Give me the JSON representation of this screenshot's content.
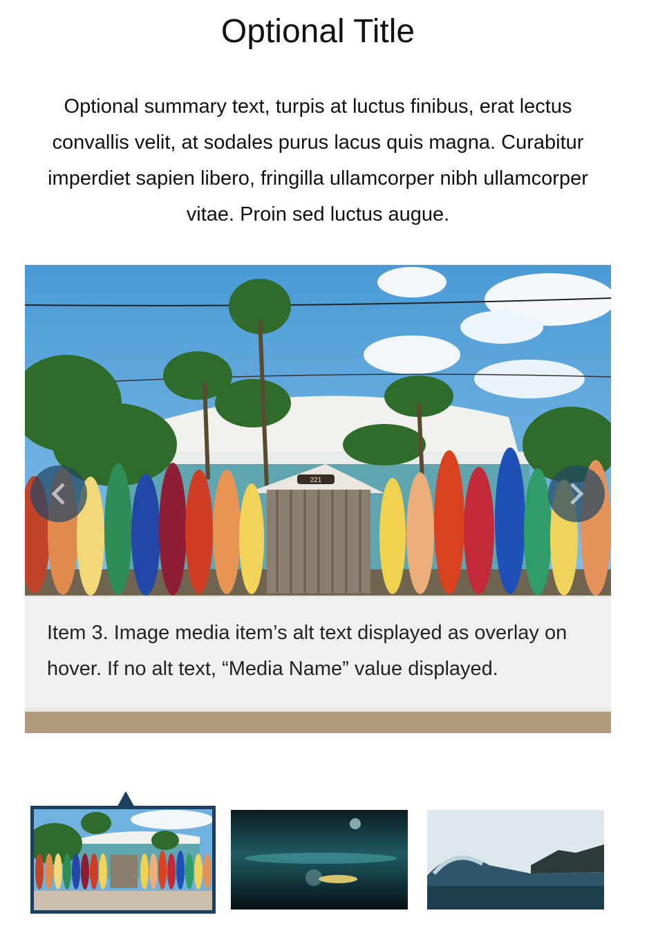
{
  "title": "Optional Title",
  "summary": "Optional summary text, turpis at luctus finibus, erat lectus convallis velit, at sodales purus lacus quis magna. Curabitur imperdiet sapien libero, fringilla ullamcorper nibh ullamcorper vitae. Proin sed luctus augue.",
  "slider": {
    "caption": "Item 3. Image media item’s alt text displayed as overlay on hover. If no alt text, “Media Name” value displayed.",
    "house_number": "221",
    "prev_icon": "chevron-left-icon",
    "next_icon": "chevron-right-icon"
  },
  "thumbnails": [
    {
      "name": "surfboards-thumbnail",
      "active": true
    },
    {
      "name": "underwater-surfer-thumbnail",
      "active": false
    },
    {
      "name": "ocean-wave-thumbnail",
      "active": false
    }
  ],
  "colors": {
    "accent": "#1d4060",
    "arrow_bg": "#234664"
  }
}
